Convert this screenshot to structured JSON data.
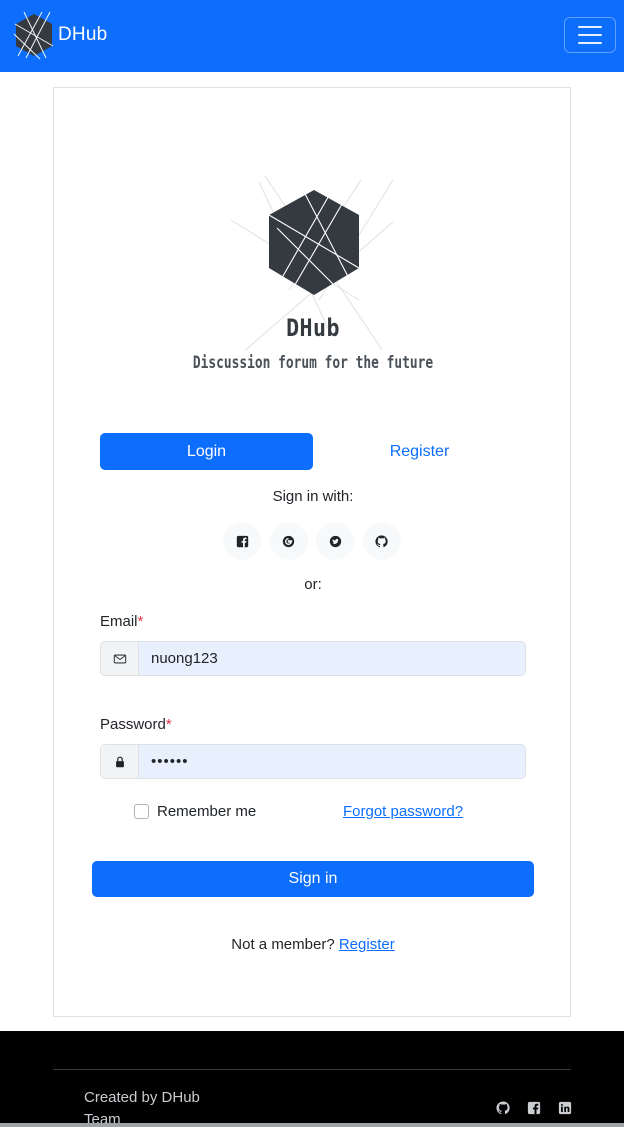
{
  "navbar": {
    "brand": "DHub",
    "accent_color": "#0d6efd",
    "menu_icon": "hamburger-menu-icon"
  },
  "hero": {
    "title": "DHub",
    "subtitle": "Discussion forum for the future"
  },
  "tabs": {
    "login_label": "Login",
    "register_label": "Register"
  },
  "social": {
    "heading": "Sign in with:",
    "icons": [
      "facebook-icon",
      "google-icon",
      "twitter-icon",
      "github-icon"
    ],
    "or_label": "or:"
  },
  "form": {
    "email_label": "Email",
    "email_value": "nuong123",
    "email_icon": "envelope-icon",
    "password_label": "Password",
    "password_value": "••••••",
    "password_icon": "lock-icon",
    "required_mark": "*",
    "remember_label": "Remember me",
    "remember_checked": false,
    "forgot_label": "Forgot password?",
    "submit_label": "Sign in",
    "not_member_text": "Not a member?",
    "register_link": "Register"
  },
  "footer": {
    "credit": "Created by DHub Team",
    "icons": [
      "github-icon",
      "facebook-icon",
      "linkedin-icon"
    ]
  }
}
